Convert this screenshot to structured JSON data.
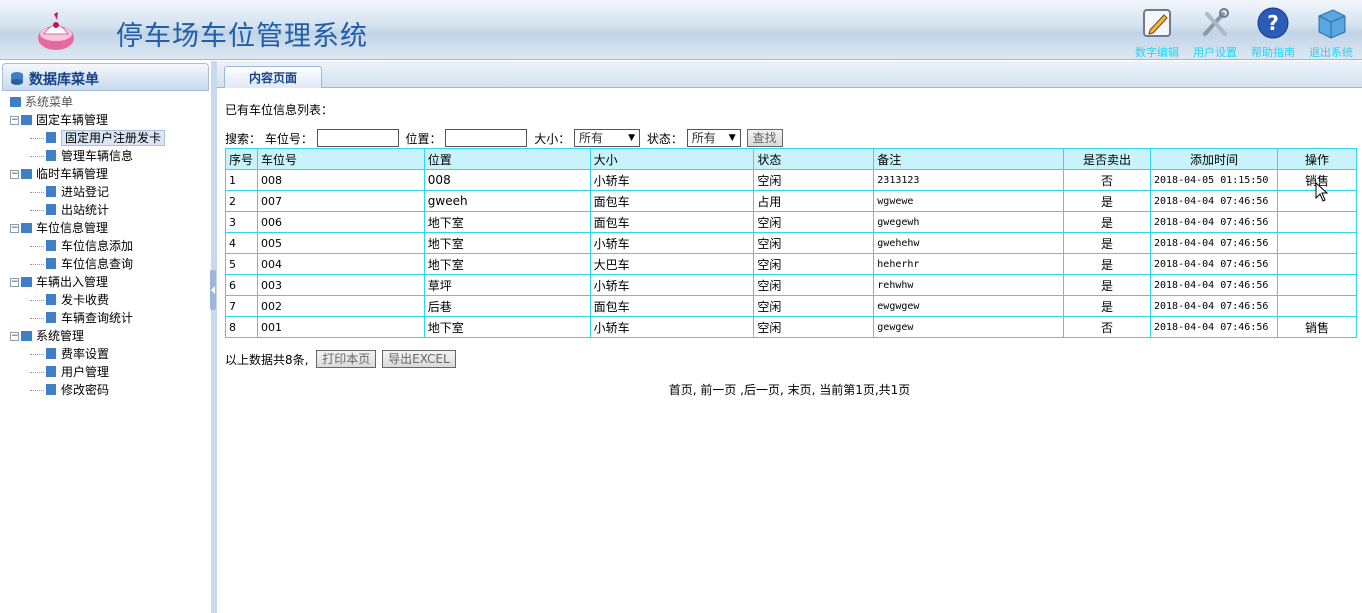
{
  "header": {
    "title": "停车场车位管理系统",
    "tools": [
      {
        "label": "数字编辑",
        "icon": "edit-icon"
      },
      {
        "label": "用户设置",
        "icon": "tools-icon"
      },
      {
        "label": "帮助指南",
        "icon": "help-icon"
      },
      {
        "label": "退出系统",
        "icon": "exit-icon"
      }
    ]
  },
  "sidebar": {
    "title": "数据库菜单",
    "root": "系统菜单",
    "groups": [
      {
        "label": "固定车辆管理",
        "items": [
          "固定用户注册发卡",
          "管理车辆信息"
        ]
      },
      {
        "label": "临时车辆管理",
        "items": [
          "进站登记",
          "出站统计"
        ]
      },
      {
        "label": "车位信息管理",
        "items": [
          "车位信息添加",
          "车位信息查询"
        ]
      },
      {
        "label": "车辆出入管理",
        "items": [
          "发卡收费",
          "车辆查询统计"
        ]
      },
      {
        "label": "系统管理",
        "items": [
          "费率设置",
          "用户管理",
          "修改密码"
        ]
      }
    ]
  },
  "main": {
    "tab_label": "内容页面",
    "list_caption": "已有车位信息列表：",
    "search": {
      "prefix": "搜索：",
      "spot_label": "车位号：",
      "spot_value": "",
      "location_label": "位置：",
      "location_value": "",
      "size_label": "大小：",
      "size_value": "所有",
      "status_label": "状态：",
      "status_value": "所有",
      "search_button": "查找"
    },
    "table": {
      "headers": [
        "序号",
        "车位号",
        "位置",
        "大小",
        "状态",
        "备注",
        "是否卖出",
        "添加时间",
        "操作"
      ],
      "rows": [
        [
          "1",
          "008",
          "008",
          "小轿车",
          "空闲",
          "2313123",
          "否",
          "2018-04-05 01:15:50",
          "销售"
        ],
        [
          "2",
          "007",
          "gweeh",
          "面包车",
          "占用",
          "wgwewe",
          "是",
          "2018-04-04 07:46:56",
          ""
        ],
        [
          "3",
          "006",
          "地下室",
          "面包车",
          "空闲",
          "gwegewh",
          "是",
          "2018-04-04 07:46:56",
          ""
        ],
        [
          "4",
          "005",
          "地下室",
          "小轿车",
          "空闲",
          "gwehehw",
          "是",
          "2018-04-04 07:46:56",
          ""
        ],
        [
          "5",
          "004",
          "地下室",
          "大巴车",
          "空闲",
          "heherhr",
          "是",
          "2018-04-04 07:46:56",
          ""
        ],
        [
          "6",
          "003",
          "草坪",
          "小轿车",
          "空闲",
          "rehwhw",
          "是",
          "2018-04-04 07:46:56",
          ""
        ],
        [
          "7",
          "002",
          "后巷",
          "面包车",
          "空闲",
          "ewgwgew",
          "是",
          "2018-04-04 07:46:56",
          ""
        ],
        [
          "8",
          "001",
          "地下室",
          "小轿车",
          "空闲",
          "gewgew",
          "否",
          "2018-04-04 07:46:56",
          "销售"
        ]
      ]
    },
    "summary": "以上数据共8条,",
    "print_button": "打印本页",
    "export_button": "导出EXCEL",
    "pager": "首页, 前一页 ,后一页, 末页, 当前第1页,共1页"
  },
  "colors": {
    "title_blue": "#1f5ea8",
    "table_border": "#35d6e8",
    "table_header_bg": "#c9f3fb",
    "tool_label": "#22d4f0"
  }
}
